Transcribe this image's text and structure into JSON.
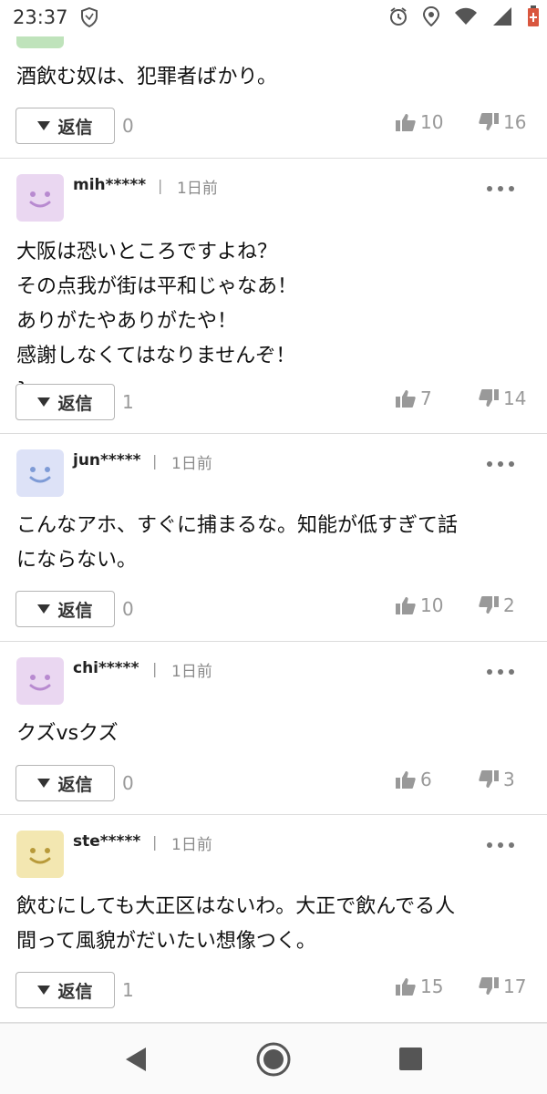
{
  "status": {
    "time": "23:37"
  },
  "colors": {
    "avatar_pink": "#ead7f1",
    "avatar_blue": "#dde2f7",
    "avatar_yellow": "#f3e7b1",
    "avatar_green": "#bfe3bb"
  },
  "previous_comment": {
    "body": "酒飲む奴は、犯罪者ばかり。",
    "reply_label": "返信",
    "reply_count": "0",
    "likes": "10",
    "dislikes": "16"
  },
  "comments": [
    {
      "username": "mih*****",
      "time": "1日前",
      "body": [
        "大阪は恐いところですよね？",
        "その点我が街は平和じゃなあ！",
        "ありがたやありがたや！",
        "感謝しなくてはなりませんぞ！"
      ],
      "reply_label": "返信",
      "reply_count": "1",
      "likes": "7",
      "dislikes": "14"
    },
    {
      "username": "jun*****",
      "time": "1日前",
      "body": [
        "こんなアホ、すぐに捕まるな。知能が低すぎて話",
        "にならない。"
      ],
      "reply_label": "返信",
      "reply_count": "0",
      "likes": "10",
      "dislikes": "2"
    },
    {
      "username": "chi*****",
      "time": "1日前",
      "body": [
        "クズvsクズ"
      ],
      "reply_label": "返信",
      "reply_count": "0",
      "likes": "6",
      "dislikes": "3"
    },
    {
      "username": "ste*****",
      "time": "1日前",
      "body": [
        "飲むにしても大正区はないわ。大正で飲んでる人",
        "間って風貌がだいたい想像つく。"
      ],
      "reply_label": "返信",
      "reply_count": "1",
      "likes": "15",
      "dislikes": "17"
    }
  ],
  "icons": {
    "status": [
      "shield-icon",
      "alarm-icon",
      "location-icon",
      "wifi-icon",
      "signal-icon",
      "battery-icon"
    ],
    "actions": [
      "chevron-down-icon",
      "thumbs-up-icon",
      "thumbs-down-icon",
      "more-icon"
    ],
    "nav": [
      "back-icon",
      "home-icon",
      "recents-icon"
    ]
  }
}
